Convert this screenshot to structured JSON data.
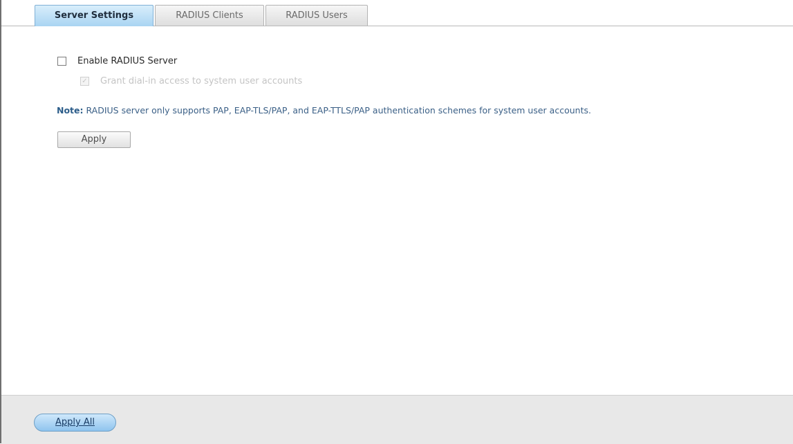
{
  "tabs": [
    {
      "label": "Server Settings",
      "active": true
    },
    {
      "label": "RADIUS Clients",
      "active": false
    },
    {
      "label": "RADIUS Users",
      "active": false
    }
  ],
  "settings": {
    "enable_radius": {
      "label": "Enable RADIUS Server",
      "checked": false
    },
    "grant_dialin": {
      "label": "Grant dial-in access to system user accounts",
      "checked": true,
      "disabled": true
    }
  },
  "note": {
    "prefix": "Note:",
    "text": " RADIUS server only supports PAP, EAP-TLS/PAP, and EAP-TTLS/PAP authentication schemes for system user accounts."
  },
  "buttons": {
    "apply": "Apply",
    "apply_all": "Apply All"
  },
  "colors": {
    "active_tab": "#a9d4f2",
    "note_text": "#3a5f86",
    "footer_bg": "#e8e8e8"
  }
}
